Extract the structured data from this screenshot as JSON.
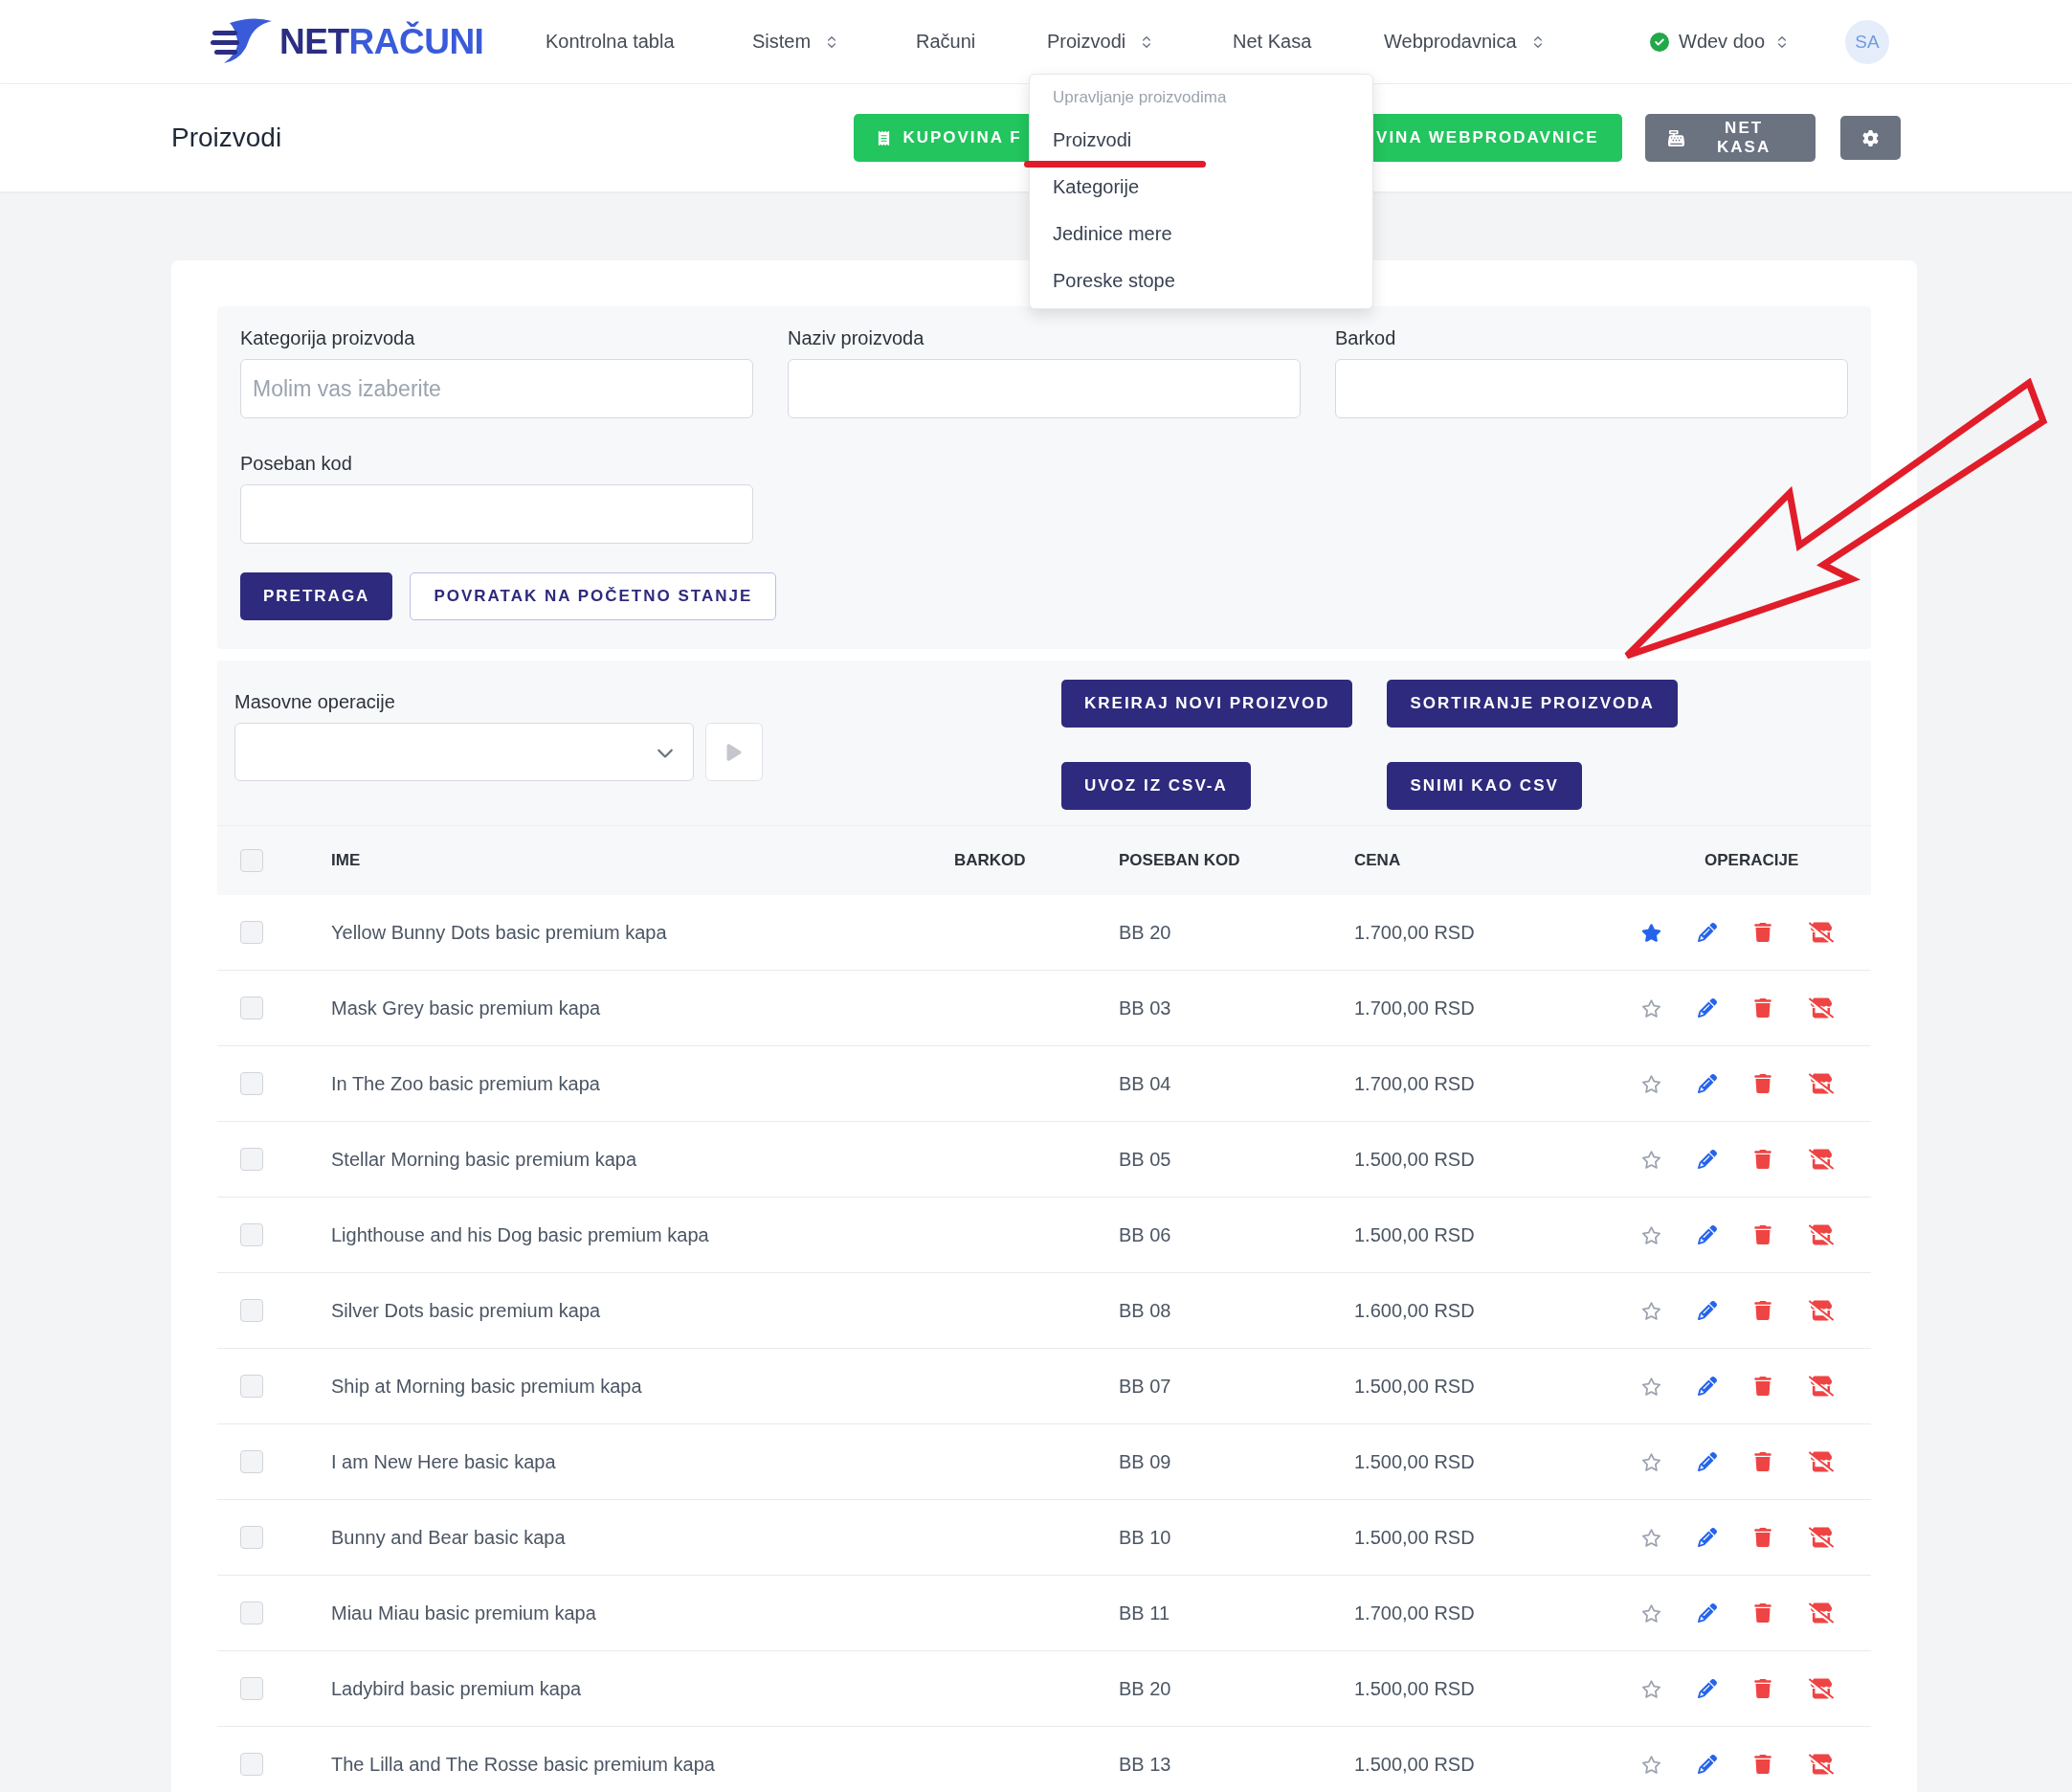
{
  "nav": {
    "logo": {
      "text_dark": "NET",
      "text_accent": "RAČUNI"
    },
    "items": [
      {
        "label": "Kontrolna tabla",
        "has_menu": false
      },
      {
        "label": "Sistem",
        "has_menu": true
      },
      {
        "label": "Računi",
        "has_menu": false
      },
      {
        "label": "Proizvodi",
        "has_menu": true
      },
      {
        "label": "Net Kasa",
        "has_menu": false
      },
      {
        "label": "Webprodavnica",
        "has_menu": true
      }
    ],
    "company": {
      "label": "Wdev doo",
      "verified": true
    },
    "avatar": "SA"
  },
  "header": {
    "title": "Proizvodi",
    "buttons": [
      {
        "label": "KUPOVINA F",
        "kind": "green"
      },
      {
        "label": "VINA WEBPRODAVNICE",
        "kind": "green-covered"
      },
      {
        "label": "NET KASA",
        "kind": "grey"
      }
    ]
  },
  "dropdown": {
    "heading": "Upravljanje proizvodima",
    "items": [
      {
        "label": "Proizvodi",
        "selected": true
      },
      {
        "label": "Kategorije",
        "selected": false
      },
      {
        "label": "Jedinice mere",
        "selected": false
      },
      {
        "label": "Poreske stope",
        "selected": false
      }
    ]
  },
  "filters": {
    "fields": [
      {
        "label": "Kategorija proizvoda",
        "placeholder": "Molim vas izaberite"
      },
      {
        "label": "Naziv proizvoda"
      },
      {
        "label": "Barkod"
      },
      {
        "label": "Poseban kod"
      }
    ],
    "search_button": "PRETRAGA",
    "reset_button": "POVRATAK NA POČETNO STANJE"
  },
  "mass": {
    "label": "Masovne operacije",
    "buttons": [
      "KREIRAJ NOVI PROIZVOD",
      "SORTIRANJE PROIZVODA",
      "UVOZ IZ CSV-A",
      "SNIMI KAO CSV"
    ]
  },
  "table": {
    "columns": [
      "IME",
      "BARKOD",
      "POSEBAN KOD",
      "CENA",
      "OPERACIJE"
    ],
    "all_checked": false,
    "rows": [
      {
        "name": "Yellow Bunny Dots basic premium kapa",
        "code": "BB 20",
        "price": "1.700,00 RSD",
        "favorite": true,
        "checked": false
      },
      {
        "name": "Mask Grey basic premium kapa",
        "code": "BB 03",
        "price": "1.700,00 RSD",
        "favorite": false,
        "checked": false
      },
      {
        "name": "In The Zoo basic premium kapa",
        "code": "BB 04",
        "price": "1.700,00 RSD",
        "favorite": false,
        "checked": false
      },
      {
        "name": "Stellar Morning basic premium kapa",
        "code": "BB 05",
        "price": "1.500,00 RSD",
        "favorite": false,
        "checked": false
      },
      {
        "name": "Lighthouse and his Dog basic premium kapa",
        "code": "BB 06",
        "price": "1.500,00 RSD",
        "favorite": false,
        "checked": false
      },
      {
        "name": "Silver Dots basic premium kapa",
        "code": "BB 08",
        "price": "1.600,00 RSD",
        "favorite": false,
        "checked": false
      },
      {
        "name": "Ship at Morning basic premium kapa",
        "code": "BB 07",
        "price": "1.500,00 RSD",
        "favorite": false,
        "checked": false
      },
      {
        "name": "I am New Here basic kapa",
        "code": "BB 09",
        "price": "1.500,00 RSD",
        "favorite": false,
        "checked": false
      },
      {
        "name": "Bunny and Bear basic kapa",
        "code": "BB 10",
        "price": "1.500,00 RSD",
        "favorite": false,
        "checked": false
      },
      {
        "name": "Miau Miau basic premium kapa",
        "code": "BB 11",
        "price": "1.700,00 RSD",
        "favorite": false,
        "checked": false
      },
      {
        "name": "Ladybird basic premium kapa",
        "code": "BB 20",
        "price": "1.500,00 RSD",
        "favorite": false,
        "checked": false
      },
      {
        "name": "The Lilla and The Rosse basic premium kapa",
        "code": "BB 13",
        "price": "1.500,00 RSD",
        "favorite": false,
        "checked": false
      }
    ]
  }
}
